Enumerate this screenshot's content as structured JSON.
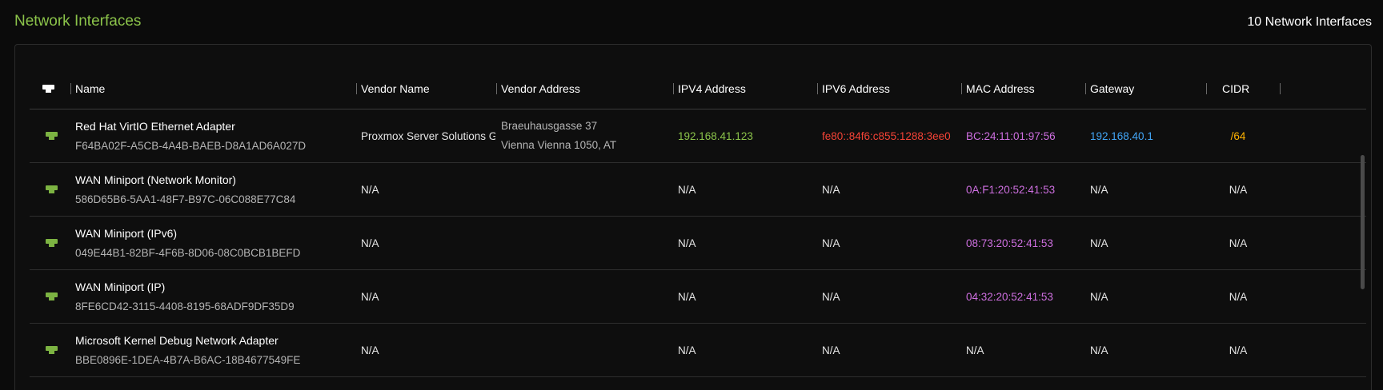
{
  "header": {
    "title": "Network Interfaces",
    "count_label": "10 Network Interfaces"
  },
  "table": {
    "columns": [
      "Name",
      "Vendor Name",
      "Vendor Address",
      "IPV4 Address",
      "IPV6 Address",
      "MAC Address",
      "Gateway",
      "CIDR"
    ],
    "header_icon": "ethernet-icon",
    "rows": [
      {
        "name": "Red Hat VirtIO Ethernet Adapter",
        "guid": "F64BA02F-A5CB-4A4B-BAEB-D8A1AD6A027D",
        "vendor_name": "Proxmox Server Solutions Gm",
        "vendor_address_line1": "Braeuhausgasse 37",
        "vendor_address_line2": "Vienna Vienna 1050, AT",
        "ipv4": "192.168.41.123",
        "ipv6": "fe80::84f6:c855:1288:3ee0",
        "mac": "BC:24:11:01:97:56",
        "gateway": "192.168.40.1",
        "cidr": "/64"
      },
      {
        "name": "WAN Miniport (Network Monitor)",
        "guid": "586D65B6-5AA1-48F7-B97C-06C088E77C84",
        "vendor_name": "N/A",
        "vendor_address_line1": "",
        "vendor_address_line2": "",
        "ipv4": "N/A",
        "ipv6": "N/A",
        "mac": "0A:F1:20:52:41:53",
        "gateway": "N/A",
        "cidr": "N/A"
      },
      {
        "name": "WAN Miniport (IPv6)",
        "guid": "049E44B1-82BF-4F6B-8D06-08C0BCB1BEFD",
        "vendor_name": "N/A",
        "vendor_address_line1": "",
        "vendor_address_line2": "",
        "ipv4": "N/A",
        "ipv6": "N/A",
        "mac": "08:73:20:52:41:53",
        "gateway": "N/A",
        "cidr": "N/A"
      },
      {
        "name": "WAN Miniport (IP)",
        "guid": "8FE6CD42-3115-4408-8195-68ADF9DF35D9",
        "vendor_name": "N/A",
        "vendor_address_line1": "",
        "vendor_address_line2": "",
        "ipv4": "N/A",
        "ipv6": "N/A",
        "mac": "04:32:20:52:41:53",
        "gateway": "N/A",
        "cidr": "N/A"
      },
      {
        "name": "Microsoft Kernel Debug Network Adapter",
        "guid": "BBE0896E-1DEA-4B7A-B6AC-18B4677549FE",
        "vendor_name": "N/A",
        "vendor_address_line1": "",
        "vendor_address_line2": "",
        "ipv4": "N/A",
        "ipv6": "N/A",
        "mac": "N/A",
        "gateway": "N/A",
        "cidr": "N/A"
      }
    ]
  },
  "colors": {
    "title": "#8bc34a",
    "icon_header": "#ffffff",
    "icon_row": "#7cb342",
    "ipv4": "#8bc34a",
    "ipv6": "#f44336",
    "mac": "#ce6fe0",
    "gateway": "#42a5f5",
    "cidr": "#ffb300"
  }
}
